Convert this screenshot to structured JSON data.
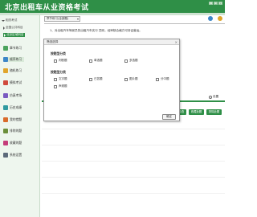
{
  "app": {
    "title": "北京出租车从业资格考试"
  },
  "window_controls": [
    "–",
    "□",
    "×"
  ],
  "sidebar": {
    "section": "相关考试",
    "subitems": [
      {
        "label": "全国公共科目",
        "active": false
      },
      {
        "label": "北京区域科目",
        "active": true
      }
    ],
    "nav": [
      {
        "label": "章节练习",
        "icon": "chapter-icon",
        "color": "#4aa35c",
        "selected": false
      },
      {
        "label": "顺序练习",
        "icon": "sequence-icon",
        "color": "#3c86c8",
        "selected": true
      },
      {
        "label": "随机练习",
        "icon": "random-icon",
        "color": "#e0a52b",
        "selected": false
      },
      {
        "label": "模拟考试",
        "icon": "exam-icon",
        "color": "#d04a3c",
        "selected": false
      },
      {
        "label": "仿真考场",
        "icon": "simulation-icon",
        "color": "#7a5bc0",
        "selected": false
      },
      {
        "label": "历史成绩",
        "icon": "history-icon",
        "color": "#2f9aa0",
        "selected": false
      },
      {
        "label": "我的错题",
        "icon": "mistakes-icon",
        "color": "#d96b2b",
        "selected": false
      },
      {
        "label": "排除的题",
        "icon": "excluded-icon",
        "color": "#6b8f3a",
        "selected": false
      },
      {
        "label": "收藏的题",
        "icon": "favorites-icon",
        "color": "#c53d7a",
        "selected": false
      },
      {
        "label": "系统设置",
        "icon": "settings-icon",
        "color": "#5c6a7a",
        "selected": false
      }
    ]
  },
  "main": {
    "breadcrumb": "章节练习(全部题)",
    "question_text": "1、对出租汽车驾驶员的出租汽车实行            顶岗，经审核合格方可持证营运。",
    "right_icons": [
      {
        "name": "round-icon-1",
        "color": "#3c86c8"
      },
      {
        "name": "round-icon-2",
        "color": "#e0a52b"
      }
    ],
    "setting_label": "设置",
    "buttons": [
      {
        "label": "答题检查",
        "name": "check-button"
      },
      {
        "label": "收藏此题",
        "name": "favorite-button"
      },
      {
        "label": "排除此题",
        "name": "exclude-button"
      }
    ]
  },
  "modal": {
    "title": "筛选选择",
    "close": "×",
    "type_group_title": "按题型分类",
    "type_options": [
      "判断题",
      "单选题",
      "多选题"
    ],
    "content_group_title": "按题型分类",
    "content_options": [
      "文字题",
      "已答题",
      "图片题",
      "分中题",
      "声频题"
    ],
    "ok_label": "确定"
  },
  "accent_color": "#2f8f47"
}
